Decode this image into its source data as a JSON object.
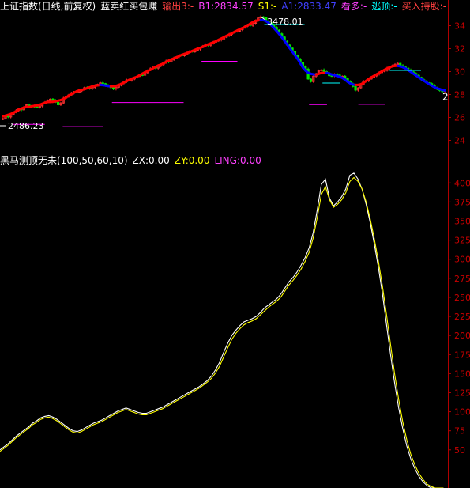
{
  "colors": {
    "background": "#000000",
    "axis": "#b00000",
    "tick_label": "#c80000",
    "up_candle": "#ff3232",
    "down_candle": "#00e600",
    "trend_up": "#ff0000",
    "trend_down": "#0000ff",
    "level_magenta": "#ff00ff",
    "level_cyan": "#00ffff",
    "osc_white": "#ffffff",
    "osc_yellow": "#ffff00"
  },
  "header_top": {
    "title": "上证指数(日线,前复权)",
    "indicator": "蓝卖红买包赚",
    "out3": "输出3:-",
    "b1": "B1:2834.57",
    "s1": "S1:-",
    "a1": "A1:2833.47",
    "kanduo": "看多:-",
    "taoding": "逃顶:-",
    "buy_hold": "买入持股:-"
  },
  "header_bottom": {
    "name": "黑马测顶无未(100,50,60,10)",
    "zx": "ZX:0.00",
    "zy": "ZY:0.00",
    "ling": "LING:0.00"
  },
  "annotations": {
    "high": "3478.01",
    "low": "2486.23",
    "last": "2"
  },
  "chart_data": [
    {
      "type": "candlestick",
      "title": "上证指数(日线,前复权)",
      "y_ticks": [
        "24",
        "26",
        "28",
        "30",
        "32",
        "34"
      ],
      "ylim": [
        2300,
        3500
      ],
      "labeled_points": {
        "high": 3478.01,
        "low": 2486.23
      },
      "close_series": [
        2590,
        2612,
        2604,
        2628,
        2645,
        2660,
        2675,
        2666,
        2690,
        2710,
        2703,
        2698,
        2692,
        2688,
        2700,
        2720,
        2734,
        2745,
        2760,
        2748,
        2732,
        2710,
        2726,
        2768,
        2780,
        2796,
        2812,
        2825,
        2818,
        2832,
        2846,
        2860,
        2857,
        2849,
        2862,
        2878,
        2889,
        2902,
        2895,
        2882,
        2869,
        2860,
        2848,
        2862,
        2879,
        2898,
        2912,
        2926,
        2920,
        2935,
        2945,
        2958,
        2972,
        2968,
        2990,
        3010,
        3025,
        3038,
        3030,
        3046,
        3060,
        3078,
        3092,
        3085,
        3102,
        3118,
        3130,
        3144,
        3138,
        3152,
        3165,
        3178,
        3172,
        3186,
        3196,
        3210,
        3223,
        3234,
        3229,
        3242,
        3256,
        3268,
        3275,
        3284,
        3300,
        3312,
        3325,
        3338,
        3348,
        3352,
        3365,
        3380,
        3395,
        3410,
        3402,
        3420,
        3448,
        3468,
        3478,
        3470,
        3440,
        3425,
        3410,
        3386,
        3362,
        3330,
        3302,
        3265,
        3232,
        3205,
        3180,
        3140,
        3108,
        3078,
        3045,
        3022,
        2935,
        2912,
        2960,
        2978,
        3012,
        3015,
        3001,
        2988,
        2964,
        2962,
        2980,
        2970,
        2955,
        2960,
        2938,
        2918,
        2895,
        2870,
        2838,
        2858,
        2890,
        2915,
        2920,
        2935,
        2950,
        2962,
        2978,
        2990,
        3002,
        3010,
        3030,
        3041,
        3052,
        3061,
        3072,
        3052,
        3040,
        3030,
        3014,
        2998,
        2984,
        2968,
        2950,
        2930,
        2915,
        2902,
        2895,
        2880,
        2862,
        2846,
        2835,
        2825,
        2833
      ]
    },
    {
      "type": "line",
      "title": "黑马测顶无未(100,50,60,10)",
      "y_ticks": [
        "50",
        "75",
        "100",
        "125",
        "150",
        "175",
        "200",
        "225",
        "250",
        "275",
        "300",
        "325",
        "350",
        "375",
        "400"
      ],
      "ylim": [
        0,
        420
      ],
      "series": [
        {
          "name": "ZX",
          "values": [
            50,
            54,
            58,
            63,
            68,
            72,
            76,
            80,
            85,
            88,
            92,
            94,
            95,
            93,
            90,
            86,
            82,
            78,
            75,
            74,
            76,
            79,
            82,
            85,
            87,
            89,
            92,
            95,
            98,
            101,
            103,
            105,
            103,
            101,
            99,
            98,
            98,
            100,
            102,
            104,
            106,
            109,
            112,
            115,
            118,
            121,
            124,
            127,
            130,
            133,
            137,
            141,
            147,
            155,
            165,
            178,
            190,
            200,
            207,
            213,
            218,
            220,
            222,
            225,
            230,
            236,
            240,
            244,
            248,
            254,
            262,
            270,
            276,
            283,
            292,
            302,
            315,
            335,
            365,
            398,
            405,
            380,
            370,
            375,
            382,
            392,
            410,
            413,
            405,
            392,
            372,
            348,
            320,
            290,
            255,
            215,
            175,
            138,
            105,
            78,
            55,
            38,
            25,
            15,
            8,
            3,
            0,
            0,
            0,
            0
          ]
        },
        {
          "name": "ZY",
          "values": [
            48,
            52,
            56,
            61,
            66,
            70,
            74,
            78,
            83,
            86,
            90,
            92,
            93,
            91,
            88,
            84,
            80,
            76,
            73,
            72,
            74,
            77,
            80,
            83,
            85,
            87,
            90,
            93,
            96,
            99,
            101,
            103,
            101,
            99,
            97,
            96,
            96,
            98,
            100,
            102,
            104,
            107,
            110,
            113,
            116,
            119,
            122,
            125,
            128,
            131,
            135,
            139,
            144,
            151,
            160,
            172,
            184,
            195,
            203,
            209,
            214,
            217,
            219,
            222,
            227,
            232,
            237,
            241,
            245,
            250,
            258,
            266,
            272,
            279,
            287,
            297,
            309,
            328,
            355,
            385,
            395,
            378,
            368,
            372,
            378,
            387,
            402,
            407,
            402,
            392,
            375,
            353,
            327,
            298,
            265,
            228,
            188,
            150,
            116,
            87,
            63,
            44,
            30,
            19,
            11,
            5,
            2,
            0,
            0,
            0
          ]
        }
      ]
    }
  ]
}
